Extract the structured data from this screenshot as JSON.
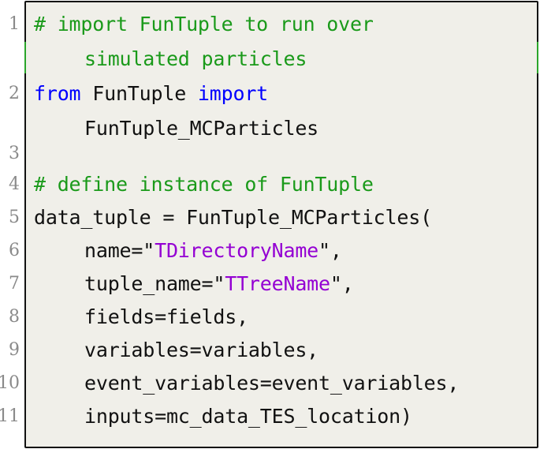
{
  "listing": {
    "language": "python",
    "colors": {
      "keyword": "#0000ff",
      "comment": "#1a9a1a",
      "string": "#9400d3",
      "text": "#111111",
      "line_number": "#8a8a8a",
      "background": "#f0efe9"
    },
    "lines": [
      {
        "num": "1",
        "comment": "# import FunTuple to run over",
        "cont_comment": "simulated particles"
      },
      {
        "num": "2",
        "kw1": "from",
        "mod": " FunTuple ",
        "kw2": "import",
        "cont": "FunTuple_MCParticles"
      },
      {
        "num": "3"
      },
      {
        "num": "4",
        "comment": "# define instance of FunTuple"
      },
      {
        "num": "5",
        "text": "data_tuple = FunTuple_MCParticles("
      },
      {
        "num": "6",
        "pre": "name=\"",
        "str": "TDirectoryName",
        "post": "\","
      },
      {
        "num": "7",
        "pre": "tuple_name=\"",
        "str": "TTreeName",
        "post": "\","
      },
      {
        "num": "8",
        "text": "fields=fields,"
      },
      {
        "num": "9",
        "text": "variables=variables,"
      },
      {
        "num": "10",
        "text": "event_variables=event_variables,"
      },
      {
        "num": "11",
        "text": "inputs=mc_data_TES_location)"
      }
    ]
  }
}
